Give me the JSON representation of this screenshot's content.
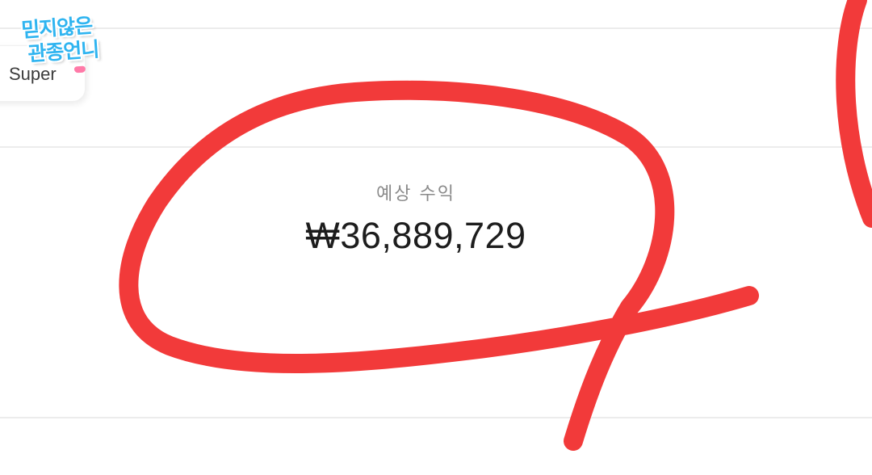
{
  "logo": {
    "line1": "믿지않은",
    "line2": "관종언니"
  },
  "filter_chip": {
    "label": "Super"
  },
  "earnings": {
    "label": "예상 수익",
    "value": "₩36,889,729"
  },
  "annotation": {
    "color": "#f23a3a"
  }
}
